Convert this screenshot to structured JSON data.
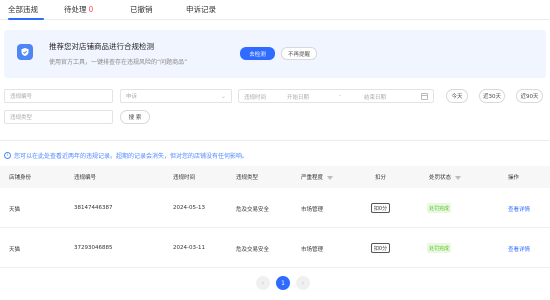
{
  "tabs": [
    {
      "label": "全部违规",
      "count": ""
    },
    {
      "label": "待处理",
      "count": "0"
    },
    {
      "label": "已撤销",
      "count": ""
    },
    {
      "label": "申诉记录",
      "count": ""
    }
  ],
  "colors": {
    "primary": "#2f6bff",
    "danger": "#ff4d4f",
    "success": "#52c41a",
    "banner_bg": "#f1f5ff"
  },
  "banner": {
    "icon": "shield-check-icon",
    "title": "推荐您对店铺商品进行合规检测",
    "description": "使用官方工具，一键排查存在违规风险的“问题商品”",
    "primary_button": "去检测",
    "secondary_button": "不再提醒"
  },
  "filters": {
    "violation_no_placeholder": "违规编号",
    "category_placeholder": "申诉",
    "date_label": "违规时间",
    "start_date_placeholder": "开始日期",
    "range_separator": "-",
    "end_date_placeholder": "结束日期",
    "quick": [
      "今天",
      "近30天",
      "近90天"
    ],
    "type_placeholder": "违规类型",
    "search_button": "搜 索"
  },
  "notice": "您可以在此处查看近两年的违规记录。超期的记录会消失，但对您的店铺没有任何影响。",
  "table": {
    "columns": [
      "店铺身份",
      "违规编号",
      "违规时间",
      "违规类型",
      "严重程度",
      "扣分",
      "处罚状态",
      "操作"
    ],
    "rows": [
      {
        "identity": "天猫",
        "number": "38147446387",
        "time": "2024-05-13",
        "type": "危及交易安全",
        "severity": "市场管理",
        "score": "扣0分",
        "status": "处罚完成",
        "action": "查看详情"
      },
      {
        "identity": "天猫",
        "number": "37293046885",
        "time": "2024-03-11",
        "type": "危及交易安全",
        "severity": "市场管理",
        "score": "扣0分",
        "status": "处罚完成",
        "action": "查看详情"
      }
    ]
  },
  "pagination": {
    "prev": "‹",
    "current": "1",
    "next": "›"
  }
}
